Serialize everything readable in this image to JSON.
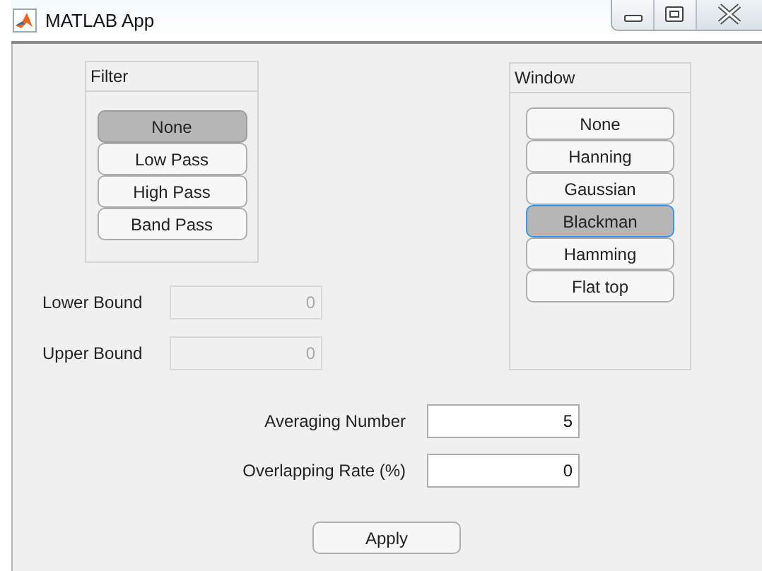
{
  "window": {
    "title": "MATLAB App"
  },
  "filter": {
    "title": "Filter",
    "options": [
      {
        "label": "None",
        "selected": true
      },
      {
        "label": "Low Pass",
        "selected": false
      },
      {
        "label": "High Pass",
        "selected": false
      },
      {
        "label": "Band Pass",
        "selected": false
      }
    ]
  },
  "window_panel": {
    "title": "Window",
    "options": [
      {
        "label": "None",
        "selected": false
      },
      {
        "label": "Hanning",
        "selected": false
      },
      {
        "label": "Gaussian",
        "selected": false
      },
      {
        "label": "Blackman",
        "selected": true
      },
      {
        "label": "Hamming",
        "selected": false
      },
      {
        "label": "Flat top",
        "selected": false
      }
    ]
  },
  "bounds": [
    {
      "label": "Lower Bound",
      "value": "0",
      "disabled": true
    },
    {
      "label": "Upper Bound",
      "value": "0",
      "disabled": true
    }
  ],
  "parameters": [
    {
      "label": "Averaging Number",
      "value": "5",
      "disabled": false
    },
    {
      "label": "Overlapping Rate (%)",
      "value": "0",
      "disabled": false
    }
  ],
  "apply_button": {
    "label": "Apply"
  }
}
